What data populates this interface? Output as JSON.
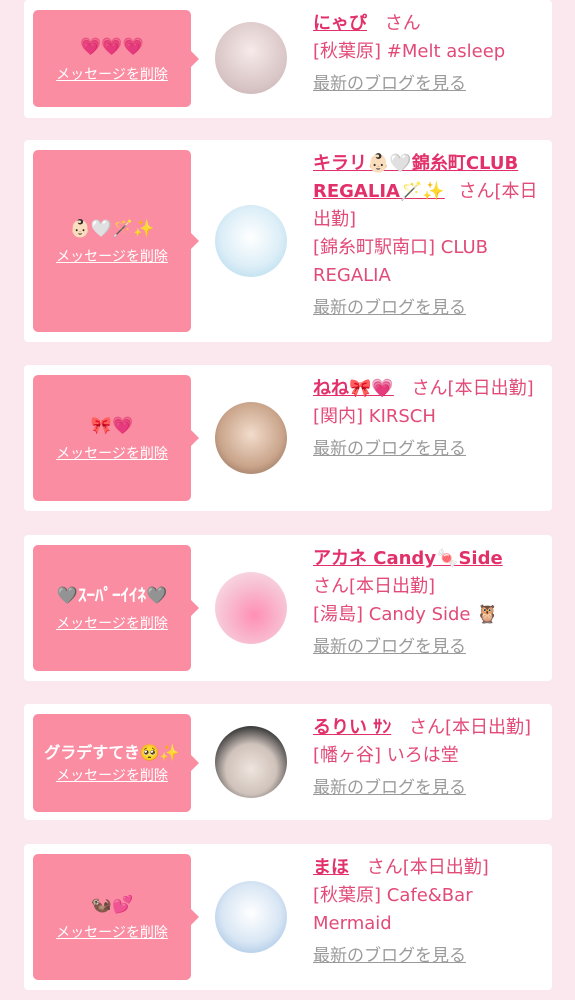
{
  "cards": [
    {
      "message": "💗💗💗",
      "delete_label": "メッセージを削除",
      "name": "にゃぴ",
      "suffix": "さん",
      "area": "[秋葉原] #Melt asleep",
      "blog_label": "最新のブログを見る",
      "avatar_colors": [
        "#d8c8c8",
        "#f2e6e6"
      ]
    },
    {
      "message": "👶🏻🤍🪄✨",
      "delete_label": "メッセージを削除",
      "name": "キラリ👶🏻🤍錦糸町CLUB REGALIA🪄✨",
      "suffix": "さん[本日出勤]",
      "area": "[錦糸町駅南口] CLUB REGALIA",
      "blog_label": "最新のブログを見る",
      "avatar_colors": [
        "#bfe3f0",
        "#f4f7fb"
      ]
    },
    {
      "message": "🎀💗",
      "delete_label": "メッセージを削除",
      "name": "ねね🎀💗",
      "suffix": "さん[本日出勤]",
      "area": "[関内] KIRSCH",
      "blog_label": "最新のブログを見る",
      "avatar_colors": [
        "#c9a88f",
        "#efd9c8"
      ]
    },
    {
      "message": "🩶ｽｰﾊﾟｰｲｲﾈ🩶",
      "delete_label": "メッセージを削除",
      "name": "アカネ Candy🍬Side",
      "suffix": "さん[本日出勤]",
      "area": "[湯島] Candy Side 🦉",
      "blog_label": "最新のブログを見る",
      "avatar_colors": [
        "#f5b5c8",
        "#fbe9ef"
      ]
    },
    {
      "message": "グラデすてき🥺✨",
      "delete_label": "メッセージを削除",
      "name": "るりい ｻﾝ",
      "suffix": "さん[本日出勤]",
      "area": "[幡ヶ谷] いろは堂",
      "blog_label": "最新のブログを見る",
      "avatar_colors": [
        "#6a6a6a",
        "#e6dcd6"
      ]
    },
    {
      "message": "🦦💕",
      "delete_label": "メッセージを削除",
      "name": "まほ",
      "suffix": "さん[本日出勤]",
      "area": "[秋葉原] Cafe&Bar Mermaid",
      "blog_label": "最新のブログを見る",
      "avatar_colors": [
        "#a7c8e8",
        "#eef3fb"
      ]
    }
  ]
}
